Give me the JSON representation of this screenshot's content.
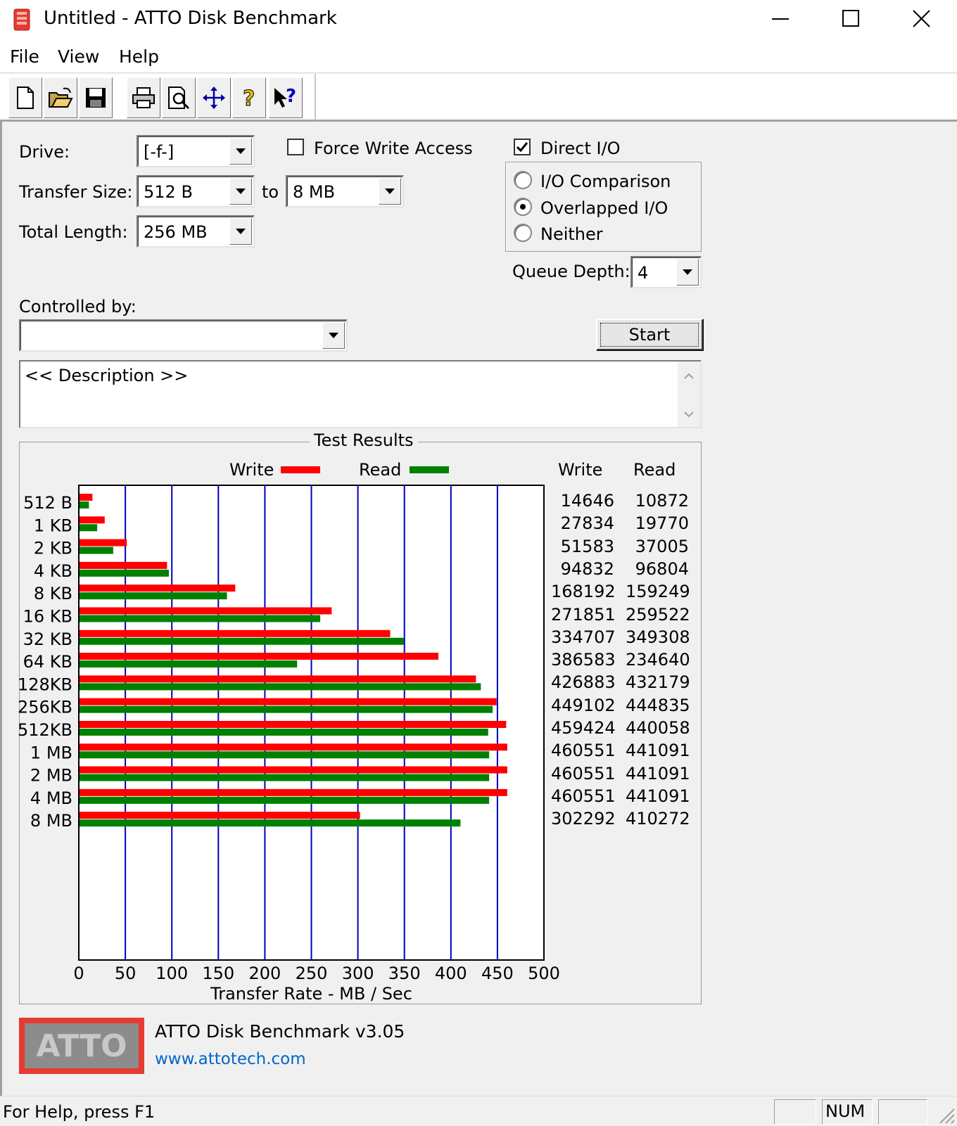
{
  "window": {
    "title": "Untitled - ATTO Disk Benchmark"
  },
  "menu": {
    "items": [
      "File",
      "View",
      "Help"
    ]
  },
  "toolbar": {
    "buttons": [
      "new-icon",
      "open-icon",
      "save-icon",
      "print-icon",
      "print-preview-icon",
      "move-icon",
      "help-icon",
      "context-help-icon"
    ]
  },
  "form": {
    "drive_label": "Drive:",
    "drive_value": "[-f-]",
    "force_write_label": "Force Write Access",
    "force_write_checked": false,
    "direct_io_label": "Direct I/O",
    "direct_io_checked": true,
    "transfer_size_label": "Transfer Size:",
    "transfer_from": "512 B",
    "to_label": "to",
    "transfer_to": "8 MB",
    "total_length_label": "Total Length:",
    "total_length_value": "256 MB",
    "io_options": [
      {
        "label": "I/O Comparison",
        "selected": false
      },
      {
        "label": "Overlapped I/O",
        "selected": true
      },
      {
        "label": "Neither",
        "selected": false
      }
    ],
    "queue_depth_label": "Queue Depth:",
    "queue_depth_value": "4",
    "controlled_by_label": "Controlled by:",
    "controlled_by_value": "",
    "start_label": "Start",
    "description": "<< Description >>"
  },
  "results": {
    "title": "Test Results",
    "write_col": "Write",
    "read_col": "Read",
    "xlabel": "Transfer Rate - MB / Sec",
    "write_color": "#ff0000",
    "read_color": "#008000",
    "grid_color": "#0000c0"
  },
  "chart_data": {
    "type": "bar",
    "orientation": "horizontal",
    "categories": [
      "512 B",
      "1 KB",
      "2 KB",
      "4 KB",
      "8 KB",
      "16 KB",
      "32 KB",
      "64 KB",
      "128KB",
      "256KB",
      "512KB",
      "1 MB",
      "2 MB",
      "4 MB",
      "8 MB"
    ],
    "series": [
      {
        "name": "Write",
        "values": [
          14646,
          27834,
          51583,
          94832,
          168192,
          271851,
          334707,
          386583,
          426883,
          449102,
          459424,
          460551,
          460551,
          460551,
          302292
        ]
      },
      {
        "name": "Read",
        "values": [
          10872,
          19770,
          37005,
          96804,
          159249,
          259522,
          349308,
          234640,
          432179,
          444835,
          440058,
          441091,
          441091,
          441091,
          410272
        ]
      }
    ],
    "xlim": [
      0,
      500
    ],
    "xticks": [
      0,
      50,
      100,
      150,
      200,
      250,
      300,
      350,
      400,
      450,
      500
    ],
    "xlabel": "Transfer Rate - MB / Sec",
    "legend": "top"
  },
  "footer": {
    "logo_text": "ATTO",
    "version": "ATTO Disk Benchmark v3.05",
    "website": "www.attotech.com"
  },
  "statusbar": {
    "text": "For Help, press F1",
    "num": "NUM"
  }
}
